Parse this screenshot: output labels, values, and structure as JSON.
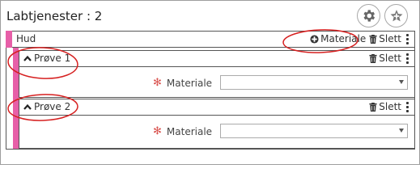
{
  "panel": {
    "title": "Labtjenester : 2",
    "settings_icon": "gear-icon",
    "favorite_icon": "star-plus-icon"
  },
  "group": {
    "label": "Hud",
    "add_material_label": "Materiale",
    "delete_label": "Slett"
  },
  "samples": [
    {
      "label": "Prøve 1",
      "delete_label": "Slett",
      "field_label": "Materiale",
      "field_value": ""
    },
    {
      "label": "Prøve 2",
      "delete_label": "Slett",
      "field_label": "Materiale",
      "field_value": ""
    }
  ],
  "colors": {
    "accent_pink": "#e75fa8",
    "annotation_red": "#d62020"
  }
}
